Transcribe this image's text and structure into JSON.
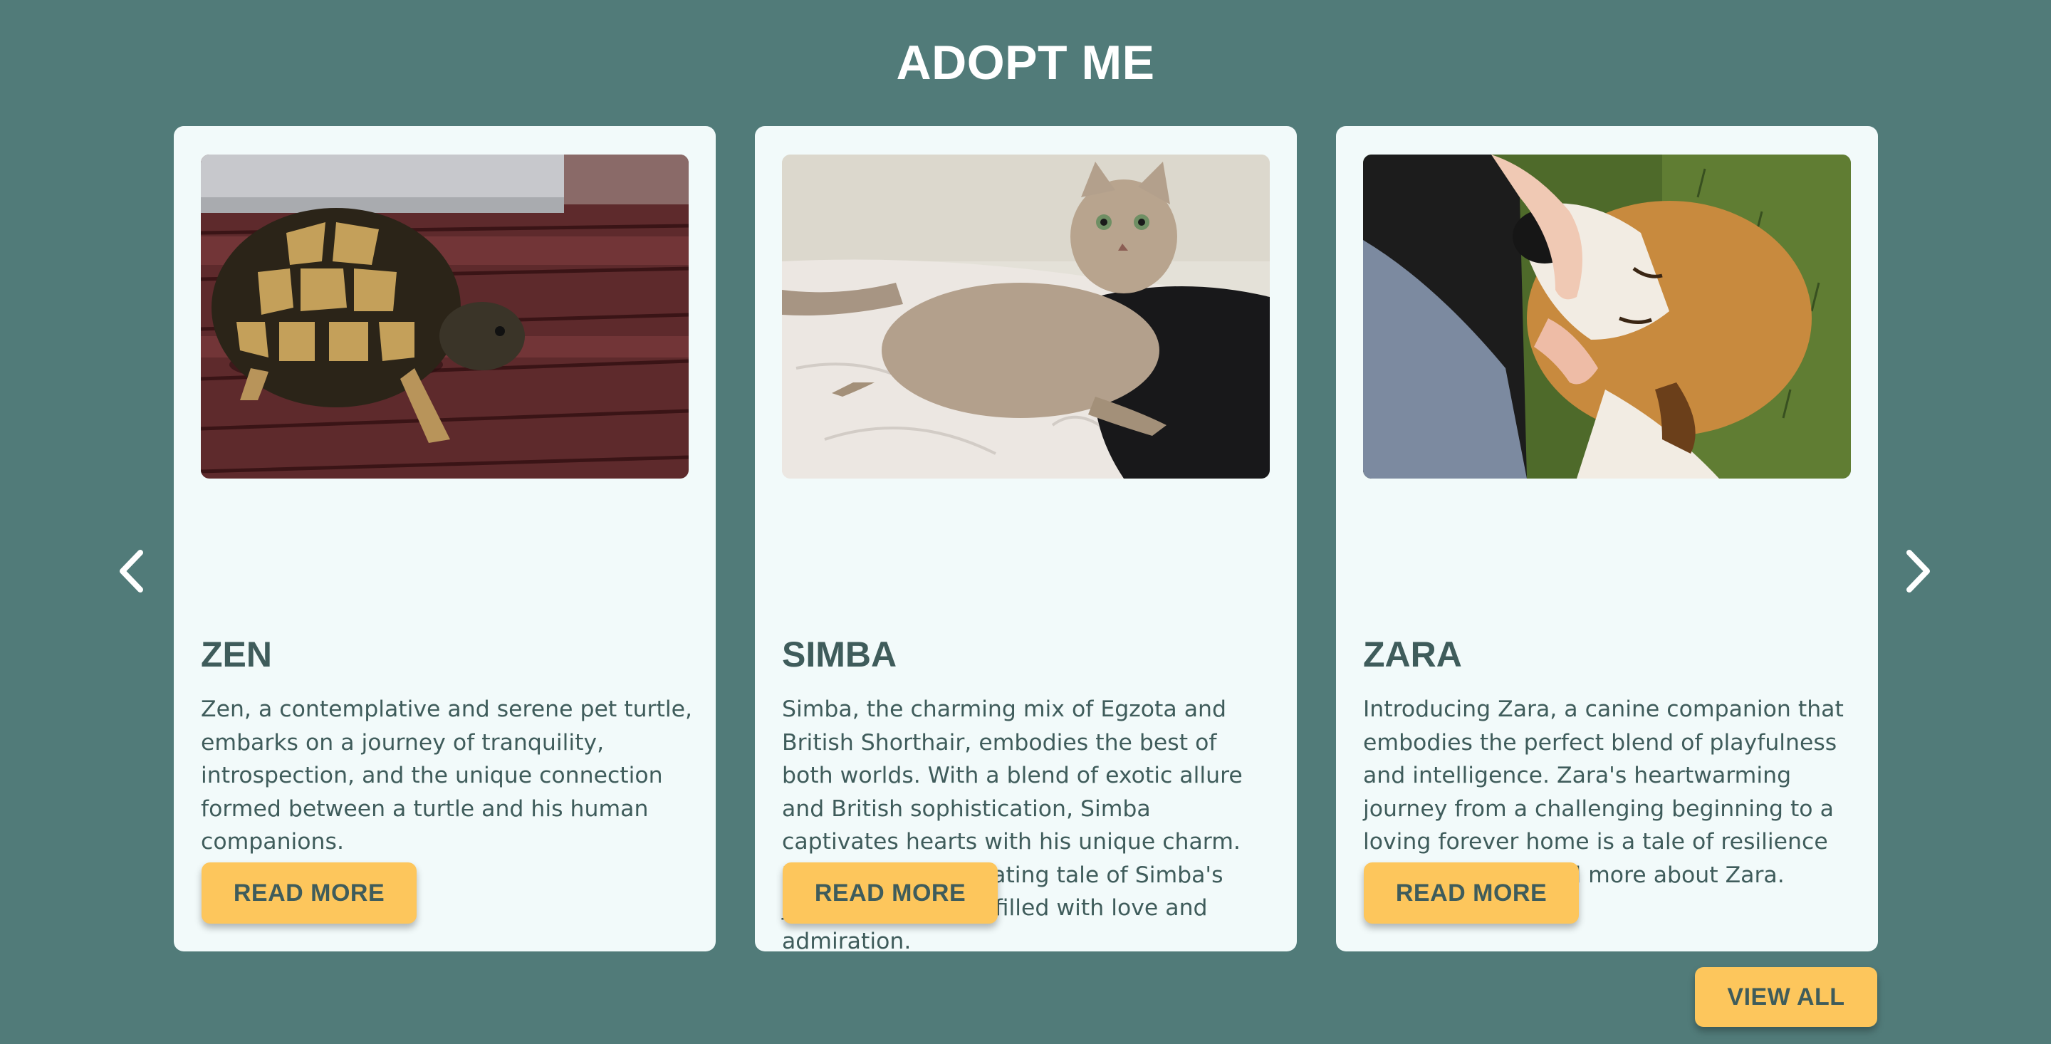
{
  "section": {
    "title": "ADOPT ME"
  },
  "carousel": {
    "prev_icon": "chevron-left-icon",
    "next_icon": "chevron-right-icon",
    "icon_color": "#ffffff"
  },
  "cards": [
    {
      "image_alt": "turtle photo",
      "name": "ZEN",
      "description": "Zen, a contemplative and serene pet turtle, embarks on a journey of tranquility, introspection, and the unique connection formed between a turtle and his human companions.",
      "button_label": "READ MORE"
    },
    {
      "image_alt": "cat photo",
      "name": "SIMBA",
      "description": "Simba, the charming mix of Egzota and British Shorthair, embodies the best of both worlds. With a blend of exotic allure and British sophistication, Simba captivates hearts with his unique charm. Uncover the fascinating tale of Simba's journey to a home filled with love and admiration.",
      "button_label": "READ MORE"
    },
    {
      "image_alt": "dog photo",
      "name": "ZARA",
      "description": "Introducing Zara, a canine companion that embodies the perfect blend of playfulness and intelligence. Zara's heartwarming journey from a challenging beginning to a loving forever home is a tale of resilience and devotion. Read more about Zara.",
      "button_label": "READ MORE"
    }
  ],
  "footer": {
    "view_all_label": "VIEW ALL"
  },
  "colors": {
    "background": "#517b79",
    "card": "#f2fafa",
    "text": "#3f5c5b",
    "button": "#fdc65c"
  }
}
